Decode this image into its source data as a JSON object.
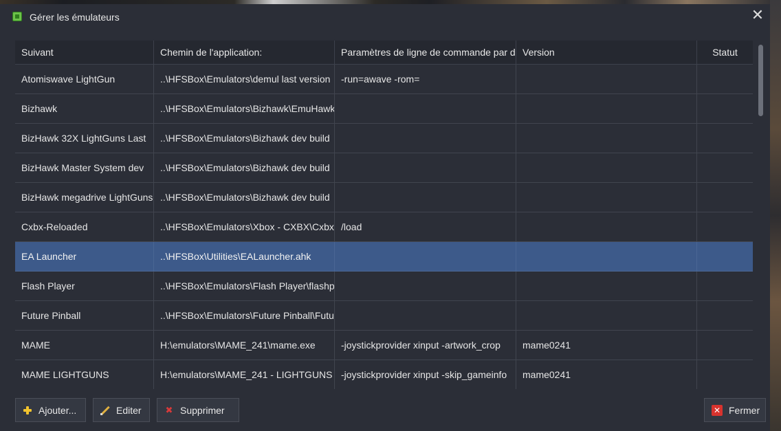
{
  "window": {
    "title": "Gérer les émulateurs",
    "close_glyph": "✕",
    "icon": "app-icon"
  },
  "table": {
    "columns": [
      "Suivant",
      "Chemin de l'application:",
      "Paramètres de ligne de commande par défaut",
      "Version",
      "Statut"
    ],
    "selected_row": 6,
    "rows": [
      [
        "Atomiswave LightGun",
        "..\\HFSBox\\Emulators\\demul last version",
        "-run=awave -rom=",
        "",
        ""
      ],
      [
        "Bizhawk",
        "..\\HFSBox\\Emulators\\Bizhawk\\EmuHawk.exe",
        "",
        "",
        ""
      ],
      [
        "BizHawk 32X LightGuns Last",
        "..\\HFSBox\\Emulators\\Bizhawk dev build",
        "",
        "",
        ""
      ],
      [
        "BizHawk Master System dev",
        "..\\HFSBox\\Emulators\\Bizhawk dev build",
        "",
        "",
        ""
      ],
      [
        "BizHawk megadrive LightGuns",
        "..\\HFSBox\\Emulators\\Bizhawk dev build",
        "",
        "",
        ""
      ],
      [
        "Cxbx-Reloaded",
        "..\\HFSBox\\Emulators\\Xbox - CXBX\\Cxbx",
        "/load",
        "",
        ""
      ],
      [
        "EA Launcher",
        "..\\HFSBox\\Utilities\\EALauncher.ahk",
        "",
        "",
        ""
      ],
      [
        "Flash Player",
        "..\\HFSBox\\Emulators\\Flash Player\\flashplayer",
        "",
        "",
        ""
      ],
      [
        "Future Pinball",
        "..\\HFSBox\\Emulators\\Future Pinball\\Future",
        "",
        "",
        ""
      ],
      [
        "MAME",
        "H:\\emulators\\MAME_241\\mame.exe",
        "-joystickprovider xinput -artwork_crop",
        "mame0241",
        ""
      ],
      [
        "MAME LIGHTGUNS",
        "H:\\emulators\\MAME_241 - LIGHTGUNS",
        "-joystickprovider xinput -skip_gameinfo",
        "mame0241",
        ""
      ]
    ]
  },
  "buttons": {
    "add": "Ajouter...",
    "edit": "Editer",
    "delete": "Supprimer",
    "close": "Fermer"
  },
  "colors": {
    "background": "#2b2e37",
    "header": "#252830",
    "selection": "#3d5a8a",
    "add_icon": "#f2c32e",
    "delete_icon": "#d83a3a"
  }
}
